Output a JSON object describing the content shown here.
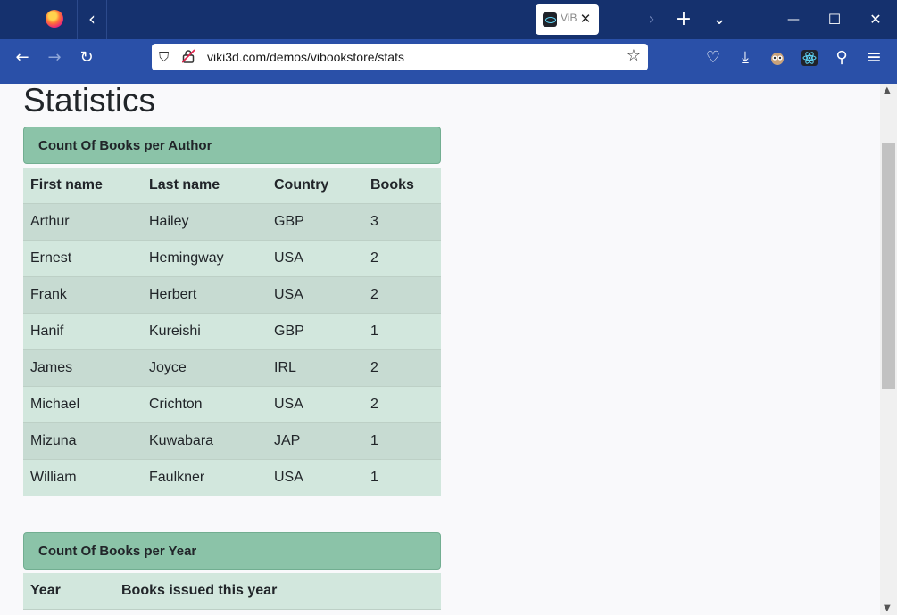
{
  "browser": {
    "tab_title": "ViBo",
    "url": "viki3d.com/demos/vibookstore/stats"
  },
  "icons": {
    "back_tabs": "‹",
    "new_tab": "+",
    "list_tabs": "⌄",
    "minimize": "—",
    "maximize": "☐",
    "close": "✕",
    "forward_tabs": "›",
    "nav_back": "←",
    "nav_forward": "→",
    "reload": "↻",
    "shield": "⛉",
    "star": "☆",
    "pocket": "♡",
    "download": "⤓",
    "extensions": "⚲",
    "menu": "≡"
  },
  "page": {
    "title": "Statistics",
    "authors_card": {
      "heading": "Count Of Books per Author",
      "columns": [
        "First name",
        "Last name",
        "Country",
        "Books"
      ],
      "rows": [
        [
          "Arthur",
          "Hailey",
          "GBP",
          "3"
        ],
        [
          "Ernest",
          "Hemingway",
          "USA",
          "2"
        ],
        [
          "Frank",
          "Herbert",
          "USA",
          "2"
        ],
        [
          "Hanif",
          "Kureishi",
          "GBP",
          "1"
        ],
        [
          "James",
          "Joyce",
          "IRL",
          "2"
        ],
        [
          "Michael",
          "Crichton",
          "USA",
          "2"
        ],
        [
          "Mizuna",
          "Kuwabara",
          "JAP",
          "1"
        ],
        [
          "William",
          "Faulkner",
          "USA",
          "1"
        ]
      ]
    },
    "years_card": {
      "heading": "Count Of Books per Year",
      "columns": [
        "Year",
        "Books issued this year"
      ]
    }
  },
  "colors": {
    "titlebar": "#15316e",
    "navbar": "#2a50a8",
    "card_header": "#8bc3a8",
    "row_dark": "#c7dbd2",
    "row_light": "#d2e7dd"
  }
}
